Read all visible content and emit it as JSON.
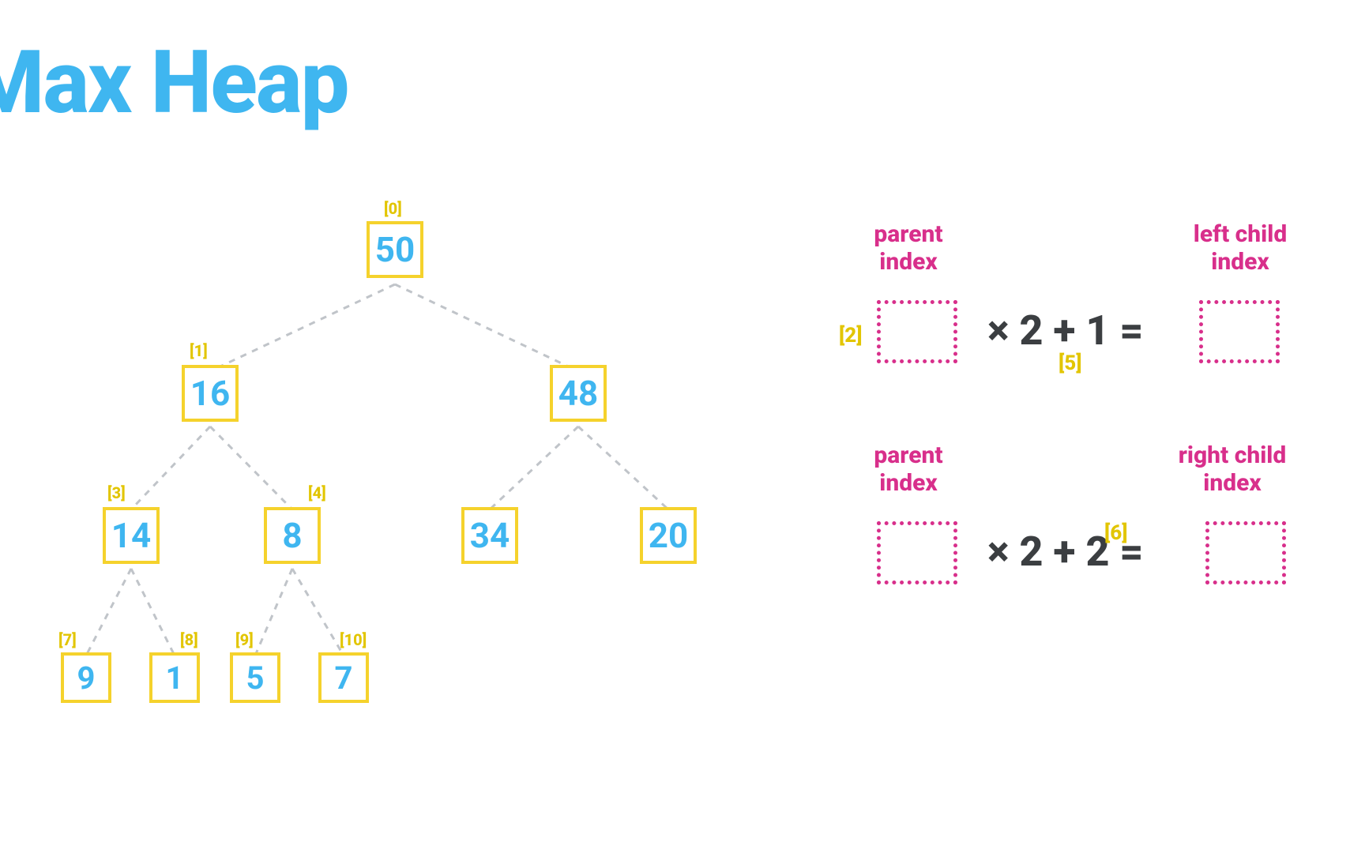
{
  "title": "Max Heap",
  "heap": {
    "nodes": [
      {
        "i": "[0]",
        "v": "50"
      },
      {
        "i": "[1]",
        "v": "16"
      },
      {
        "i": "",
        "v": "48"
      },
      {
        "i": "[3]",
        "v": "14"
      },
      {
        "i": "[4]",
        "v": "8"
      },
      {
        "i": "",
        "v": "34"
      },
      {
        "i": "",
        "v": "20"
      },
      {
        "i": "[7]",
        "v": "9"
      },
      {
        "i": "[8]",
        "v": "1"
      },
      {
        "i": "[9]",
        "v": "5"
      },
      {
        "i": "[10]",
        "v": "7"
      }
    ]
  },
  "formula_left_child": {
    "parent_label": "parent\nindex",
    "child_label": "left child\nindex",
    "parent_tag": "[2]",
    "result_tag": "[5]",
    "times": "× 2 + 1 ="
  },
  "formula_right_child": {
    "parent_label": "parent\nindex",
    "child_label": "right child\nindex",
    "result_tag": "[6]",
    "times": "× 2 + 2 ="
  }
}
